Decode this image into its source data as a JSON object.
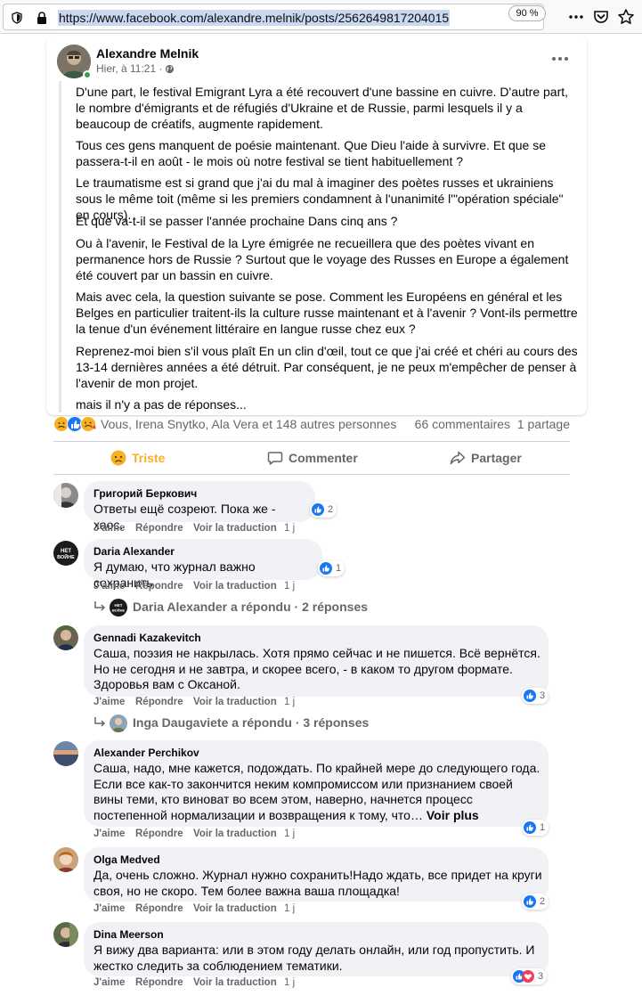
{
  "browser": {
    "url": "https://www.facebook.com/alexandre.melnik/posts/2562649817204015",
    "zoom": "90 %"
  },
  "post": {
    "author": "Alexandre Melnik",
    "time": "Hier, à 11:21 ·",
    "paragraphs": [
      "D'une part, le festival Emigrant Lyra a été recouvert d'une bassine en cuivre. D'autre part, le nombre d'émigrants et de réfugiés d'Ukraine et de Russie, parmi lesquels il y a beaucoup de créatifs, augmente rapidement.",
      "Tous ces gens manquent de poésie maintenant. Que Dieu l'aide à survivre. Et que se passera-t-il en août - le mois où notre festival se tient habituellement ?",
      "Le traumatisme est si grand que j'ai du mal à imaginer des poètes russes et ukrainiens sous le même toit (même si les premiers condamnent à l'unanimité l'\"opération spéciale\" en cours).",
      "Et que va-t-il se passer l'année prochaine Dans cinq ans ?",
      "Ou à l'avenir, le Festival de la Lyre émigrée ne recueillera que des poètes vivant en permanence hors de Russie ? Surtout que le voyage des Russes en Europe a également été couvert par un bassin en cuivre.",
      "Mais avec cela, la question suivante se pose. Comment les Européens en général et les Belges en particulier traitent-ils la culture russe maintenant et à l'avenir ? Vont-ils permettre la tenue d'un événement littéraire en langue russe chez eux ?",
      "Reprenez-moi bien s'il vous plaît En un clin d'œil, tout ce que j'ai créé et chéri au cours des 13-14 dernières années a été détruit. Par conséquent, je ne peux m'empêcher de penser à l'avenir de mon projet.",
      "mais il n'y a pas de réponses..."
    ],
    "reactions_names": "Vous, Irena Snytko, Ala Vera et 148 autres personnes",
    "comments_count": "66 commentaires",
    "shares_count": "1 partage"
  },
  "actions": {
    "triste": "Triste",
    "comment": "Commenter",
    "share": "Partager"
  },
  "comment_actions": {
    "like": "J'aime",
    "reply": "Répondre",
    "translate": "Voir la traduction",
    "time": "1 j"
  },
  "comments": [
    {
      "name": "Григорий Беркович",
      "text": "Ответы ещё созреют. Пока же - хаос.",
      "reactions": "2"
    },
    {
      "name": "Daria Alexander",
      "text": "Я думаю, что журнал важно сохранить",
      "reactions": "1",
      "reply_summary": "Daria Alexander a répondu · 2 réponses"
    },
    {
      "name": "Gennadi Kazakevitch",
      "text": "Саша, поэзия не накрылась. Хотя прямо сейчас и не пишется. Всё вернётся. Но не сегодня и не завтра, и скорее всего, - в каком то другом формате. Здоровья вам с Оксаной.",
      "reactions": "3",
      "reply_summary": "Inga Daugaviete a répondu · 3 réponses"
    },
    {
      "name": "Alexander Perchikov",
      "text": "Саша, надо, мне кажется, подождать. По крайней мере до следующего года. Если все как-то закончится неким компромиссом или признанием своей вины теми, кто виноват во всем этом, наверно, начнется процесс постепенной нормализации и возвращения к тому, что…",
      "see_more": "Voir plus",
      "reactions": "1"
    },
    {
      "name": "Olga Medved",
      "text": "Да, очень сложно. Журнал нужно сохранить!Надо ждать, все придет на круги своя, но не скоро. Тем более важна ваша площадка!",
      "reactions": "2"
    },
    {
      "name": "Dina Meerson",
      "text": "Я вижу два варианта: или в этом году делать онлайн, или год пропустить. И жестко следить за соблюдением тематики.",
      "reactions": "3"
    }
  ],
  "avatar_texts": {
    "daria": "НЕТ ВОЙНЕ"
  },
  "colors": {
    "accent": "#1877f2",
    "triste": "#f7b125",
    "bubble": "#f0f2f5",
    "secondary_text": "#65676b"
  }
}
